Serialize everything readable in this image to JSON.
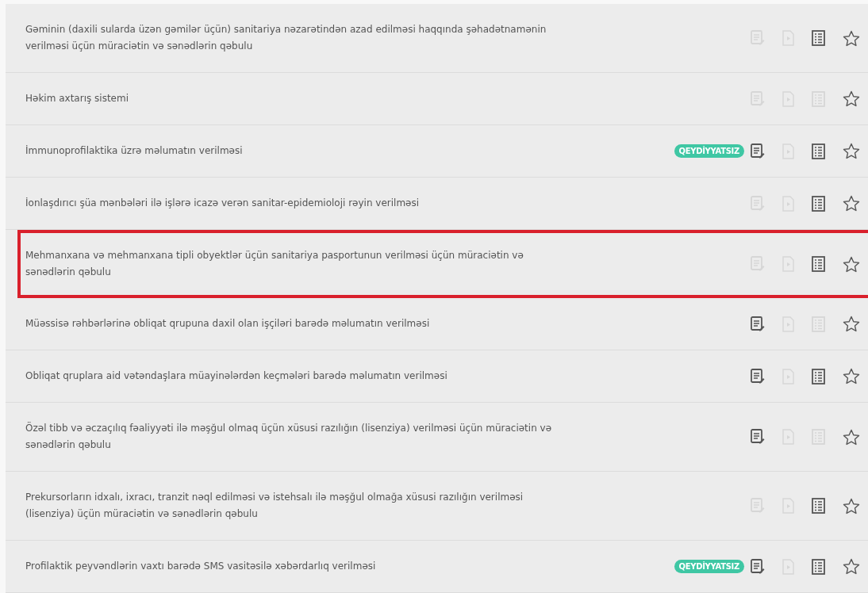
{
  "services": [
    {
      "text": "Gəminin (daxili sularda üzən gəmilər üçün) sanitariya nəzarətindən azad edilməsi haqqında şəhadətnamənin verilməsi üçün müraciətin və sənədlərin qəbulu",
      "highlighted": false,
      "apply_enabled": false,
      "file_enabled": false,
      "info_enabled": true
    },
    {
      "text": "Həkim axtarış sistemi",
      "highlighted": false,
      "apply_enabled": false,
      "file_enabled": false,
      "info_enabled": false
    },
    {
      "text": "İmmunoprofilaktika üzrə məlumatın verilməsi",
      "badge": "QEYDİYYATSIZ",
      "highlighted": false,
      "apply_enabled": true,
      "file_enabled": false,
      "info_enabled": true
    },
    {
      "text": "İonlaşdırıcı şüa mənbələri ilə işlərə icazə verən sanitar-epidemioloji rəyin verilməsi",
      "highlighted": false,
      "apply_enabled": false,
      "file_enabled": false,
      "info_enabled": true
    },
    {
      "text": "Mehmanxana və mehmanxana tipli obyektlər üçün sanitariya pasportunun verilməsi üçün müraciətin və sənədlərin qəbulu",
      "highlighted": true,
      "apply_enabled": false,
      "file_enabled": false,
      "info_enabled": true
    },
    {
      "text": "Müəssisə rəhbərlərinə obliqat qrupuna daxil olan işçiləri barədə məlumatın verilməsi",
      "highlighted": false,
      "apply_enabled": true,
      "file_enabled": false,
      "info_enabled": false
    },
    {
      "text": "Obliqat qruplara aid vətəndaşlara müayinələrdən keçmələri barədə məlumatın verilməsi",
      "highlighted": false,
      "apply_enabled": true,
      "file_enabled": false,
      "info_enabled": true
    },
    {
      "text": "Özəl tibb və əczaçılıq fəaliyyəti ilə məşğul olmaq üçün xüsusi razılığın (lisenziya) verilməsi üçün müraciətin və sənədlərin qəbulu",
      "highlighted": false,
      "apply_enabled": true,
      "file_enabled": false,
      "info_enabled": false
    },
    {
      "text": "Prekursorların idxalı, ixracı, tranzit nəql edilməsi və istehsalı ilə məşğul olmağa xüsusi razılığın verilməsi (lisenziya) üçün müraciətin və sənədlərin qəbulu",
      "highlighted": false,
      "apply_enabled": false,
      "file_enabled": false,
      "info_enabled": true
    },
    {
      "text": "Profilaktik peyvəndlərin vaxtı barədə SMS vasitəsilə xəbərdarlıq verilməsi",
      "badge": "QEYDİYYATSIZ",
      "highlighted": false,
      "apply_enabled": true,
      "file_enabled": false,
      "info_enabled": true
    }
  ]
}
